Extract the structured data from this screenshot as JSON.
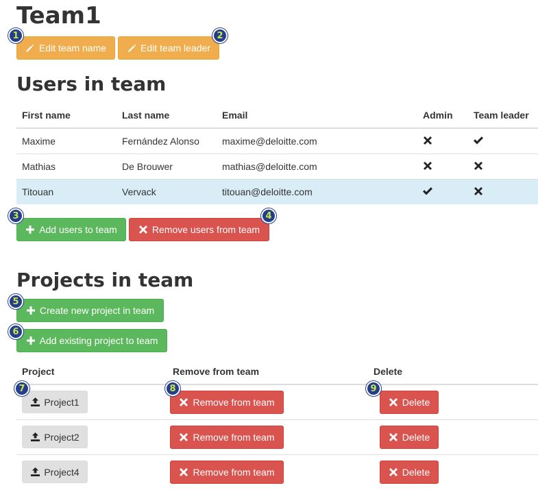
{
  "page": {
    "title": "Team1"
  },
  "team_buttons": {
    "edit_name": "Edit team name",
    "edit_leader": "Edit team leader"
  },
  "users_section": {
    "heading": "Users in team",
    "columns": [
      "First name",
      "Last name",
      "Email",
      "Admin",
      "Team leader"
    ],
    "rows": [
      {
        "first": "Maxime",
        "last": "Fernández Alonso",
        "email": "maxime@deloitte.com",
        "admin": "cross",
        "leader": "check",
        "selected": false
      },
      {
        "first": "Mathias",
        "last": "De Brouwer",
        "email": "mathias@deloitte.com",
        "admin": "cross",
        "leader": "cross",
        "selected": false
      },
      {
        "first": "Titouan",
        "last": "Vervack",
        "email": "titouan@deloitte.com",
        "admin": "check",
        "leader": "cross",
        "selected": true
      }
    ],
    "add_button": "Add users to team",
    "remove_button": "Remove users from team"
  },
  "projects_section": {
    "heading": "Projects in team",
    "create_button": "Create new project in team",
    "add_existing_button": "Add existing project to team",
    "columns": [
      "Project",
      "Remove from team",
      "Delete"
    ],
    "rows": [
      {
        "project": "Project1",
        "remove": "Remove from team",
        "delete": "Delete"
      },
      {
        "project": "Project2",
        "remove": "Remove from team",
        "delete": "Delete"
      },
      {
        "project": "Project4",
        "remove": "Remove from team",
        "delete": "Delete"
      }
    ]
  },
  "badges": [
    "1",
    "2",
    "3",
    "4",
    "5",
    "6",
    "7",
    "8",
    "9"
  ],
  "colors": {
    "warning": "#f0ad4e",
    "success": "#5cb85c",
    "danger": "#d9534f",
    "default": "#e0e0e0",
    "selected_row": "#d9edf7",
    "badge_bg": "#243e8c",
    "badge_text": "#c8e64a"
  },
  "icons": {
    "edit": "pencil-icon",
    "add": "plus-icon",
    "remove": "cross-icon",
    "project": "upload-icon",
    "yes": "check-icon",
    "no": "cross-icon"
  }
}
